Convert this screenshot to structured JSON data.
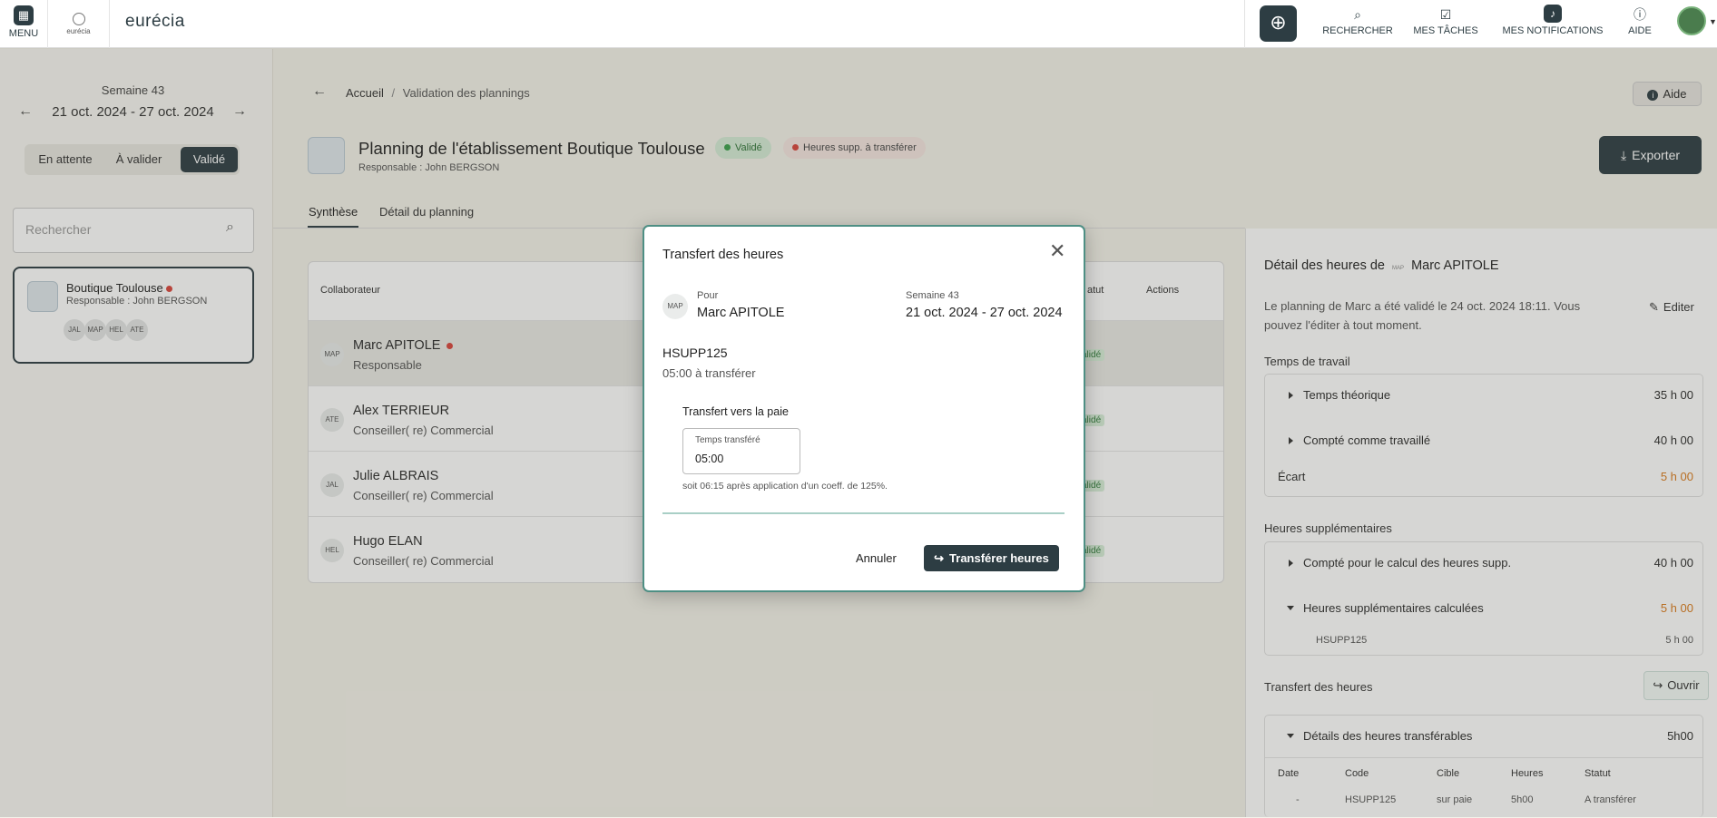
{
  "topbar": {
    "menu": "MENU",
    "logo_small": "eurécia",
    "logo": "eurécia",
    "search": "RECHERCHER",
    "tasks": "MES TÂCHES",
    "notifications": "MES NOTIFICATIONS",
    "help": "AIDE"
  },
  "sidebar": {
    "week_label": "Semaine 43",
    "week_range": "21 oct. 2024 - 27 oct. 2024",
    "seg_pending": "En attente",
    "seg_to_validate": "À valider",
    "seg_validated": "Validé",
    "search_placeholder": "Rechercher",
    "card": {
      "title": "Boutique Toulouse",
      "subtitle": "Responsable : John BERGSON",
      "chips": [
        "JAL",
        "MAP",
        "HEL",
        "ATE"
      ]
    }
  },
  "breadcrumb": {
    "home": "Accueil",
    "sep": "/",
    "current": "Validation des plannings"
  },
  "help_button": "Aide",
  "header": {
    "title": "Planning de l'établissement Boutique Toulouse",
    "badge_validated": "Validé",
    "badge_hours": "Heures supp. à transférer",
    "subtitle": "Responsable : John BERGSON",
    "export": "Exporter"
  },
  "tabs": {
    "synthese": "Synthèse",
    "detail": "Détail du planning"
  },
  "table": {
    "col_collab": "Collaborateur",
    "col_status": "atut",
    "col_actions": "Actions",
    "status_value": "alidé",
    "rows": [
      {
        "initials": "MAP",
        "name": "Marc APITOLE",
        "role": "Responsable"
      },
      {
        "initials": "ATE",
        "name": "Alex TERRIEUR",
        "role": "Conseiller( re) Commercial"
      },
      {
        "initials": "JAL",
        "name": "Julie ALBRAIS",
        "role": "Conseiller( re) Commercial"
      },
      {
        "initials": "HEL",
        "name": "Hugo ELAN",
        "role": "Conseiller( re) Commercial"
      }
    ]
  },
  "detail": {
    "title_prefix": "Détail des heures de",
    "initials": "MAP",
    "name": "Marc APITOLE",
    "info": "Le planning de Marc a été validé le 24 oct. 2024 18:11. Vous pouvez l'éditer à tout moment.",
    "edit": "Editer",
    "work_title": "Temps de travail",
    "theoretical": "Temps théorique",
    "theoretical_v": "35 h 00",
    "counted": "Compté comme travaillé",
    "counted_v": "40 h 00",
    "gap": "Écart",
    "gap_v": "5 h 00",
    "ot_title": "Heures supplémentaires",
    "ot_counted": "Compté pour le calcul des heures supp.",
    "ot_counted_v": "40 h 00",
    "ot_calc": "Heures supplémentaires calculées",
    "ot_calc_v": "5 h 00",
    "ot_code": "HSUPP125",
    "ot_code_v": "5 h 00",
    "transfer_title": "Transfert des heures",
    "open": "Ouvrir",
    "transferable": "Détails des heures transférables",
    "transferable_v": "5h00",
    "cols": [
      "Date",
      "Code",
      "Cible",
      "Heures",
      "Statut"
    ],
    "row": [
      "-",
      "HSUPP125",
      "sur paie",
      "5h00",
      "A transférer"
    ]
  },
  "modal": {
    "title": "Transfert des heures",
    "for_label": "Pour",
    "initials": "MAP",
    "name": "Marc APITOLE",
    "week_label": "Semaine 43",
    "week_range": "21 oct. 2024 - 27 oct. 2024",
    "code": "HSUPP125",
    "to_transfer": "05:00 à transférer",
    "payroll_label": "Transfert vers la paie",
    "field_label": "Temps transféré",
    "field_value": "05:00",
    "note": "soit 06:15 après application d'un coeff. de 125%.",
    "cancel": "Annuler",
    "submit": "Transférer heures"
  }
}
